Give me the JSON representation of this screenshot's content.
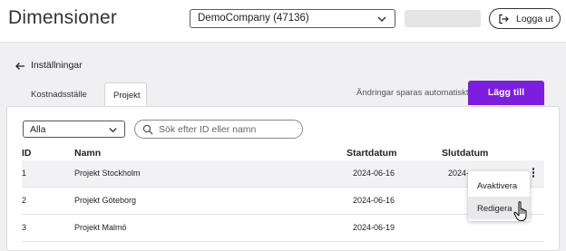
{
  "header": {
    "title": "Dimensioner",
    "company_select": "DemoCompany (47136)",
    "logout_label": "Logga ut"
  },
  "nav": {
    "back_label": "Inställningar"
  },
  "tabs": [
    {
      "label": "Kostnadsställe",
      "active": false
    },
    {
      "label": "Projekt",
      "active": true
    }
  ],
  "toolbar": {
    "autosave_text": "Ändringar sparas automatiskt",
    "add_label": "Lägg till"
  },
  "filters": {
    "status_value": "Alla",
    "search_placeholder": "Sök efter ID eller namn"
  },
  "table": {
    "columns": [
      "ID",
      "Namn",
      "Startdatum",
      "Slutdatum"
    ],
    "rows": [
      {
        "id": "1",
        "name": "Projekt Stockholm",
        "start": "2024-06-16",
        "end": "2024-"
      },
      {
        "id": "2",
        "name": "Projekt Göteborg",
        "start": "2024-06-16",
        "end": ""
      },
      {
        "id": "3",
        "name": "Projekt Malmö",
        "start": "2024-06-19",
        "end": ""
      }
    ]
  },
  "context_menu": {
    "items": [
      "Avaktivera",
      "Redigera"
    ],
    "highlighted": "Redigera"
  },
  "colors": {
    "accent": "#7c1de0",
    "background": "#f0f0f2",
    "row_highlight": "#f2f2f4"
  },
  "icons": [
    "chevron-down-icon",
    "logout-icon",
    "arrow-left-icon",
    "search-icon",
    "kebab-menu-icon",
    "hand-cursor-icon"
  ]
}
